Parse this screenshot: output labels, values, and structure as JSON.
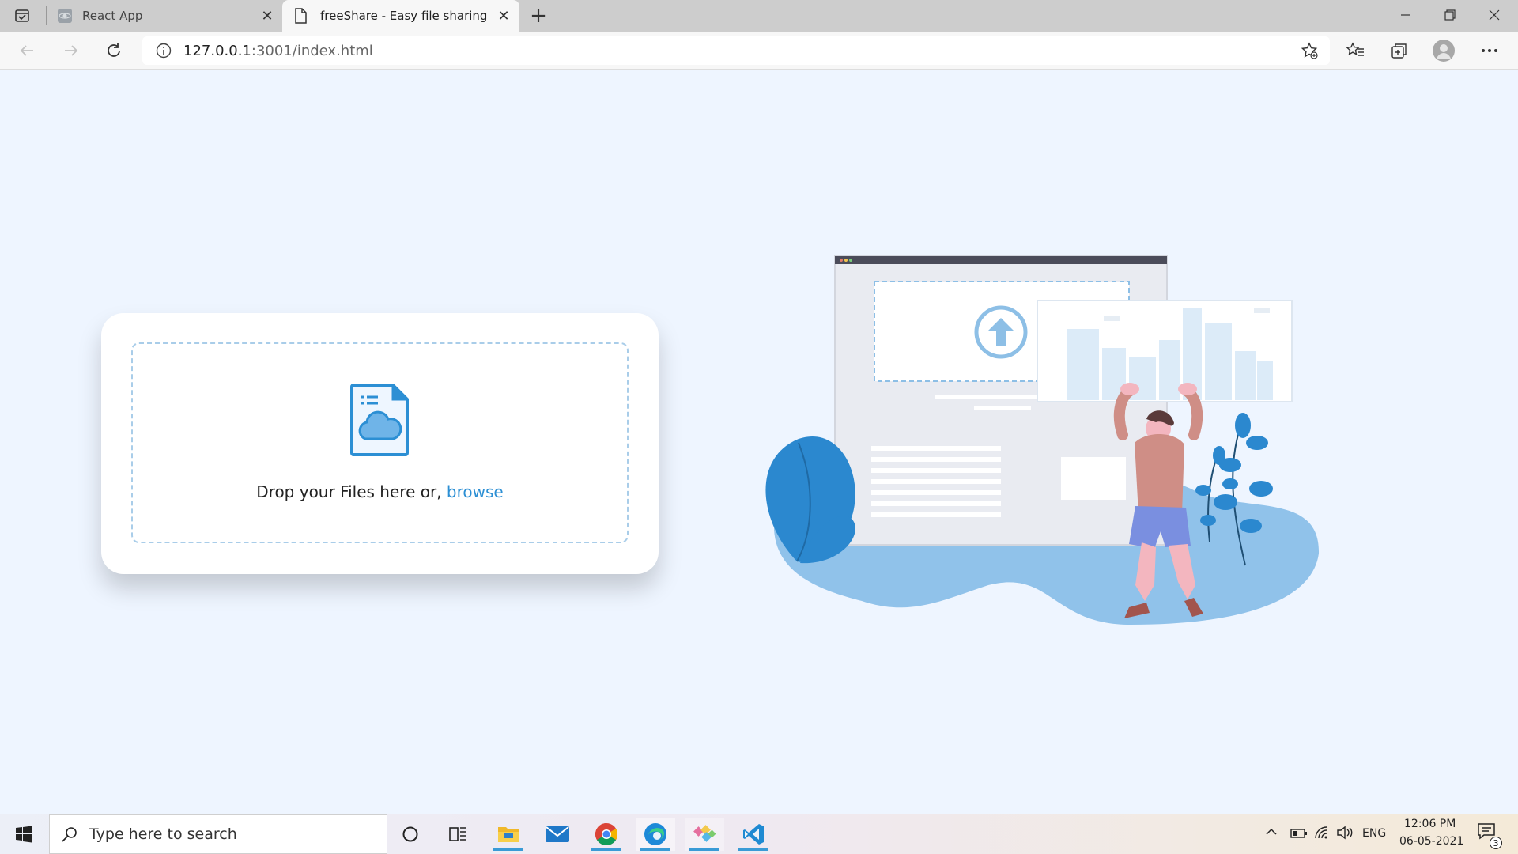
{
  "browser": {
    "tabs": [
      {
        "title": "React App",
        "active": false,
        "icon": "react-favicon"
      },
      {
        "title": "freeShare - Easy file sharing",
        "active": true,
        "icon": "page-icon"
      }
    ],
    "new_tab_symbol": "+",
    "url_host": "127.0.0.1",
    "url_path": ":3001/index.html",
    "info_symbol": "i",
    "window_controls": [
      "minimize",
      "restore",
      "close"
    ]
  },
  "page": {
    "drop_text": "Drop your Files here or,",
    "browse_label": "browse",
    "colors": {
      "accent": "#2c8fd4",
      "background": "#eef5ff",
      "card": "#ffffff",
      "dashed_border": "#a9cde9"
    }
  },
  "taskbar": {
    "search_placeholder": "Type here to search",
    "apps": [
      "task-view",
      "file-explorer",
      "mail",
      "chrome",
      "edge",
      "git-kraken",
      "vscode"
    ],
    "language": "ENG",
    "time": "12:06 PM",
    "date": "06-05-2021",
    "notification_count": "3"
  }
}
